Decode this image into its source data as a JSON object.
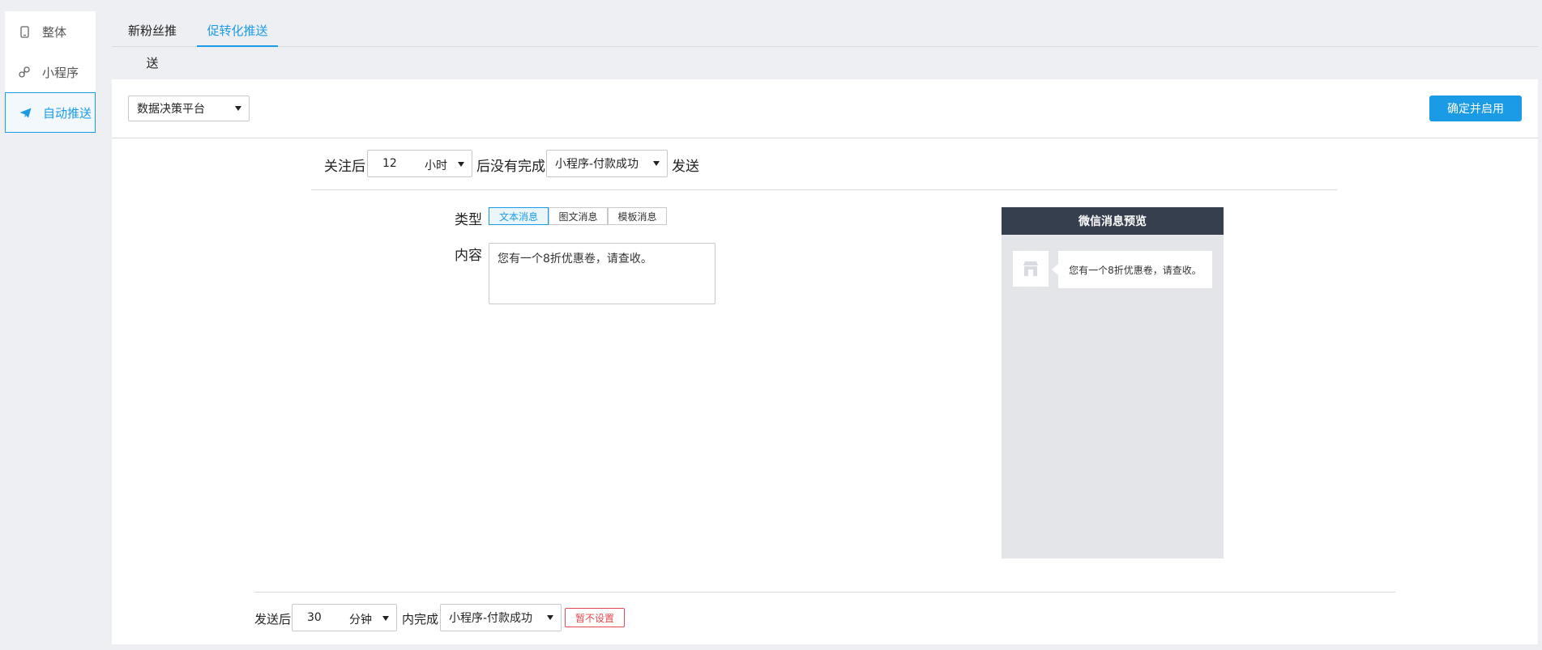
{
  "sidebar": {
    "items": [
      {
        "label": "整体",
        "icon": "phone-icon"
      },
      {
        "label": "小程序",
        "icon": "miniprogram-icon"
      },
      {
        "label": "自动推送",
        "icon": "send-icon",
        "active": true
      }
    ]
  },
  "tabs": [
    {
      "label": "新粉丝推送"
    },
    {
      "label": "促转化推送",
      "active": true
    }
  ],
  "toolbar": {
    "platform_select": "数据决策平台",
    "confirm_label": "确定并启用"
  },
  "rule": {
    "prefix": "关注后",
    "amount": "12",
    "unit": "小时",
    "middle": "后没有完成",
    "event": "小程序-付款成功",
    "suffix": "发送"
  },
  "message": {
    "type_label": "类型",
    "types": [
      "文本消息",
      "图文消息",
      "模板消息"
    ],
    "content_label": "内容",
    "content": "您有一个8折优惠卷，请查收。"
  },
  "preview": {
    "title": "微信消息预览",
    "bubble_text": "您有一个8折优惠卷，请查收。"
  },
  "followup": {
    "prefix": "发送后",
    "amount": "30",
    "unit": "分钟",
    "middle": "内完成",
    "event": "小程序-付款成功",
    "action": "暂不设置"
  },
  "colors": {
    "accent": "#1b9be6",
    "danger": "#e7484f",
    "preview_header": "#363f4e"
  }
}
